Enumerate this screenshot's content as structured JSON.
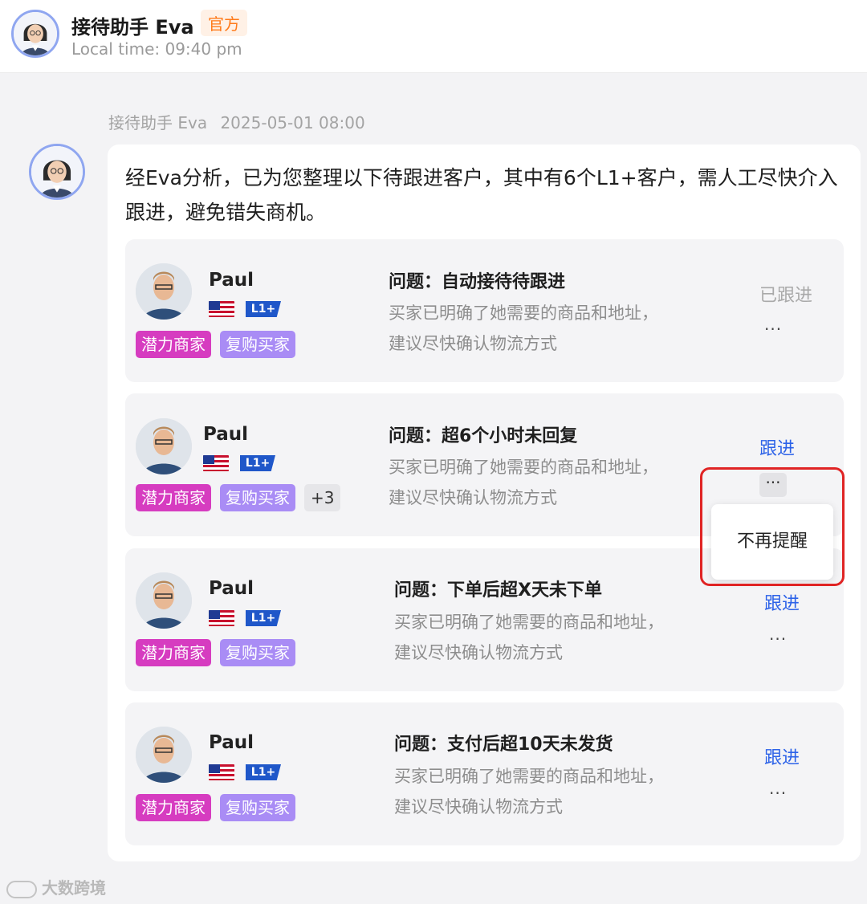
{
  "header": {
    "name": "接待助手  Eva",
    "badge": "官方",
    "local_time": "Local time: 09:40 pm"
  },
  "message": {
    "sender": "接待助手 Eva",
    "timestamp": "2025-05-01 08:00",
    "intro": "经Eva分析，已为您整理以下待跟进客户，其中有6个L1+客户，需人工尽快介入跟进，避免错失商机。"
  },
  "cards": [
    {
      "name": "Paul",
      "level": "L1+",
      "tag_a": "潜力商家",
      "tag_b": "复购买家",
      "question": "问题：自动接待待跟进",
      "desc_line1": "买家已明确了她需要的商品和地址，",
      "desc_line2": "建议尽快确认物流方式",
      "status": "已跟进",
      "more": "..."
    },
    {
      "name": "Paul",
      "level": "L1+",
      "tag_a": "潜力商家",
      "tag_b": "复购买家",
      "tag_more": "+3",
      "question": "问题：超6个小时未回复",
      "desc_line1": "买家已明确了她需要的商品和地址，",
      "desc_line2": "建议尽快确认物流方式",
      "action": "跟进",
      "more": "···"
    },
    {
      "name": "Paul",
      "level": "L1+",
      "tag_a": "潜力商家",
      "tag_b": "复购买家",
      "question": "问题：下单后超X天未下单",
      "desc_line1": "买家已明确了她需要的商品和地址，",
      "desc_line2": "建议尽快确认物流方式",
      "action": "跟进",
      "more": "..."
    },
    {
      "name": "Paul",
      "level": "L1+",
      "tag_a": "潜力商家",
      "tag_b": "复购买家",
      "question": "问题：支付后超10天未发货",
      "desc_line1": "买家已明确了她需要的商品和地址，",
      "desc_line2": "建议尽快确认物流方式",
      "action": "跟进",
      "more": "..."
    }
  ],
  "popup": {
    "label": "不再提醒"
  },
  "watermark": "大数跨境",
  "colors": {
    "accent_blue": "#2c62e8",
    "tag_potential": "#d63cc0",
    "tag_repeat": "#a98cf5",
    "official_badge": "#ff7a1a",
    "highlight_border": "#e02424"
  }
}
